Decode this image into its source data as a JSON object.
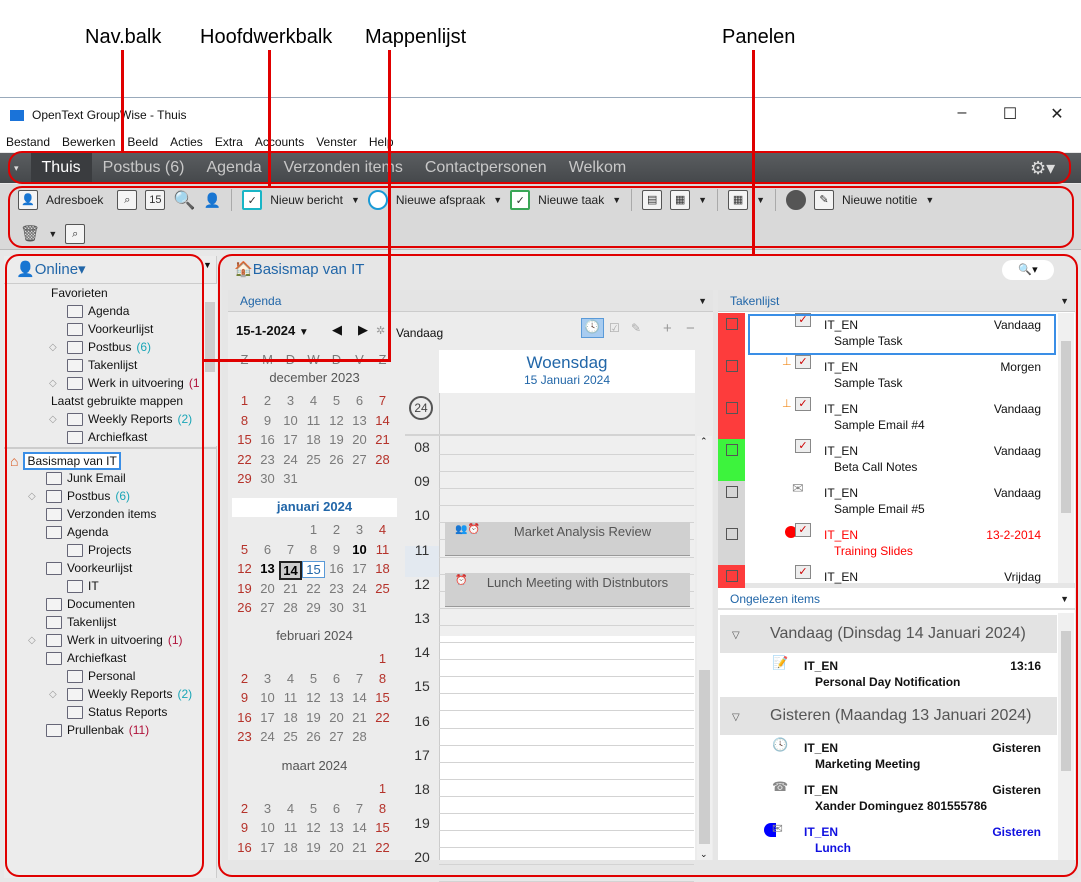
{
  "annotations": {
    "nav_bar": "Nav.balk",
    "main_toolbar": "Hoofdwerkbalk",
    "folder_list": "Mappenlijst",
    "panels": "Panelen"
  },
  "window": {
    "title": "OpenText GroupWise - Thuis",
    "minimize": "–",
    "maximize": "☐",
    "close": "✕"
  },
  "menu": [
    "Bestand",
    "Bewerken",
    "Beeld",
    "Acties",
    "Extra",
    "Accounts",
    "Venster",
    "Help"
  ],
  "nav": {
    "tabs": [
      "Thuis",
      "Postbus (6)",
      "Agenda",
      "Verzonden items",
      "Contactpersonen",
      "Welkom"
    ],
    "active": 0,
    "dropdown": "▾",
    "settings": "⚙▾"
  },
  "toolbar": {
    "address_book": "Adresboek",
    "new_message": "Nieuw bericht",
    "new_appointment": "Nieuwe afspraak",
    "new_task": "Nieuwe taak",
    "new_note": "Nieuwe notitie"
  },
  "folders": {
    "mode": "Online",
    "favorites_title": "Favorieten",
    "favorites": [
      {
        "label": "Agenda",
        "count": ""
      },
      {
        "label": "Voorkeurlijst",
        "count": ""
      },
      {
        "label": "Postbus",
        "count": "(6)"
      },
      {
        "label": "Takenlijst",
        "count": ""
      },
      {
        "label": "Werk in uitvoering",
        "count": "(1"
      }
    ],
    "recent_title": "Laatst gebruikte mappen",
    "recent": [
      {
        "label": "Weekly Reports",
        "count": "(2)"
      },
      {
        "label": "Archiefkast",
        "count": ""
      }
    ],
    "root": "Basismap van IT",
    "tree": [
      {
        "label": "Junk Email",
        "count": ""
      },
      {
        "label": "Postbus",
        "count": "(6)"
      },
      {
        "label": "Verzonden items",
        "count": ""
      },
      {
        "label": "Agenda",
        "count": ""
      },
      {
        "label": "Projects",
        "count": ""
      },
      {
        "label": "Voorkeurlijst",
        "count": ""
      },
      {
        "label": "IT",
        "count": ""
      },
      {
        "label": "Documenten",
        "count": ""
      },
      {
        "label": "Takenlijst",
        "count": ""
      },
      {
        "label": "Werk in uitvoering",
        "count": "(1)"
      },
      {
        "label": "Archiefkast",
        "count": ""
      },
      {
        "label": "Personal",
        "count": ""
      },
      {
        "label": "Weekly Reports",
        "count": "(2)"
      },
      {
        "label": "Status Reports",
        "count": ""
      },
      {
        "label": "Prullenbak",
        "count": "(11)"
      }
    ]
  },
  "home": {
    "title": "Basismap van IT",
    "search": "🔍▾"
  },
  "agenda": {
    "panel_title": "Agenda",
    "date": "15-1-2024",
    "today": "Vandaag",
    "weekdays": [
      "Z",
      "M",
      "D",
      "W",
      "D",
      "V",
      "Z"
    ],
    "months": [
      {
        "title": "december 2023",
        "weeks": [
          [
            "1",
            "2",
            "3",
            "4",
            "5",
            "6",
            "7"
          ],
          [
            "8",
            "9",
            "10",
            "11",
            "12",
            "13",
            "14"
          ],
          [
            "15",
            "16",
            "17",
            "18",
            "19",
            "20",
            "21"
          ],
          [
            "22",
            "23",
            "24",
            "25",
            "26",
            "27",
            "28"
          ],
          [
            "29",
            "30",
            "31",
            "",
            "",
            "",
            ""
          ]
        ]
      },
      {
        "title": "januari 2024",
        "weeks": [
          [
            "",
            "",
            "",
            "1",
            "2",
            "3",
            "4"
          ],
          [
            "5",
            "6",
            "7",
            "8",
            "9",
            "10",
            "11"
          ],
          [
            "12",
            "13",
            "14",
            "15",
            "16",
            "17",
            "18"
          ],
          [
            "19",
            "20",
            "21",
            "22",
            "23",
            "24",
            "25"
          ],
          [
            "26",
            "27",
            "28",
            "29",
            "30",
            "31",
            ""
          ]
        ]
      },
      {
        "title": "februari 2024",
        "weeks": [
          [
            "",
            "",
            "",
            "",
            "",
            "",
            "1"
          ],
          [
            "2",
            "3",
            "4",
            "5",
            "6",
            "7",
            "8"
          ],
          [
            "9",
            "10",
            "11",
            "12",
            "13",
            "14",
            "15"
          ],
          [
            "16",
            "17",
            "18",
            "19",
            "20",
            "21",
            "22"
          ],
          [
            "23",
            "24",
            "25",
            "26",
            "27",
            "28",
            ""
          ]
        ]
      },
      {
        "title": "maart 2024",
        "weeks": [
          [
            "",
            "",
            "",
            "",
            "",
            "",
            "1"
          ],
          [
            "2",
            "3",
            "4",
            "5",
            "6",
            "7",
            "8"
          ],
          [
            "9",
            "10",
            "11",
            "12",
            "13",
            "14",
            "15"
          ],
          [
            "16",
            "17",
            "18",
            "19",
            "20",
            "21",
            "22"
          ]
        ]
      }
    ],
    "bold_days": [
      "10",
      "13"
    ],
    "selected_day": "14",
    "current_day": "15",
    "day_name": "Woensdag",
    "day_date": "15 Januari 2024",
    "week_number": "24",
    "hours": [
      "08",
      "09",
      "10",
      "11",
      "12",
      "13",
      "14",
      "15",
      "16",
      "17",
      "18",
      "19",
      "20"
    ],
    "events": [
      {
        "title": "Market Analysis Review",
        "icons": "👥⏰"
      },
      {
        "title": "Lunch Meeting with Distnbutors",
        "icons": "⏰"
      }
    ]
  },
  "tasks": {
    "panel_title": "Takenlijst",
    "items": [
      {
        "from": "IT_EN",
        "subject": "Sample Task",
        "due": "Vandaag",
        "color": "#fd3c3c",
        "pin": false,
        "icon": "task",
        "overdue": false
      },
      {
        "from": "IT_EN",
        "subject": "Sample Task",
        "due": "Morgen",
        "color": "#fd3c3c",
        "pin": true,
        "icon": "task",
        "overdue": false
      },
      {
        "from": "IT_EN",
        "subject": "Sample Email #4",
        "due": "Vandaag",
        "color": "#fd3c3c",
        "pin": true,
        "icon": "task",
        "overdue": false
      },
      {
        "from": "IT_EN",
        "subject": "Beta Call Notes",
        "due": "Vandaag",
        "color": "#3df33d",
        "pin": false,
        "icon": "task",
        "overdue": false
      },
      {
        "from": "IT_EN",
        "subject": "Sample Email #5",
        "due": "Vandaag",
        "color": "#d6d6d6",
        "pin": false,
        "icon": "mail",
        "overdue": false
      },
      {
        "from": "IT_EN",
        "subject": "Training Slides",
        "due": "13-2-2014",
        "color": "#d6d6d6",
        "pin": false,
        "icon": "task",
        "overdue": true
      },
      {
        "from": "IT_EN",
        "subject": "",
        "due": "Vrijdag",
        "color": "#fd3c3c",
        "pin": false,
        "icon": "task",
        "overdue": false
      }
    ]
  },
  "unread": {
    "panel_title": "Ongelezen items",
    "groups": [
      {
        "title": "Vandaag (Dinsdag 14 Januari 2024)",
        "items": [
          {
            "from": "IT_EN",
            "subject": "Personal Day Notification",
            "when": "13:16",
            "icon": "note",
            "color": "#111"
          }
        ]
      },
      {
        "title": "Gisteren (Maandag 13 Januari 2024)",
        "items": [
          {
            "from": "IT_EN",
            "subject": "Marketing Meeting",
            "when": "Gisteren",
            "icon": "clock",
            "color": "#111"
          },
          {
            "from": "IT_EN",
            "subject": "Xander Dominguez 801555786",
            "when": "Gisteren",
            "icon": "phone",
            "color": "#111"
          },
          {
            "from": "IT_EN",
            "subject": "Lunch",
            "when": "Gisteren",
            "icon": "mail",
            "color": "#1010e0"
          }
        ]
      }
    ]
  }
}
